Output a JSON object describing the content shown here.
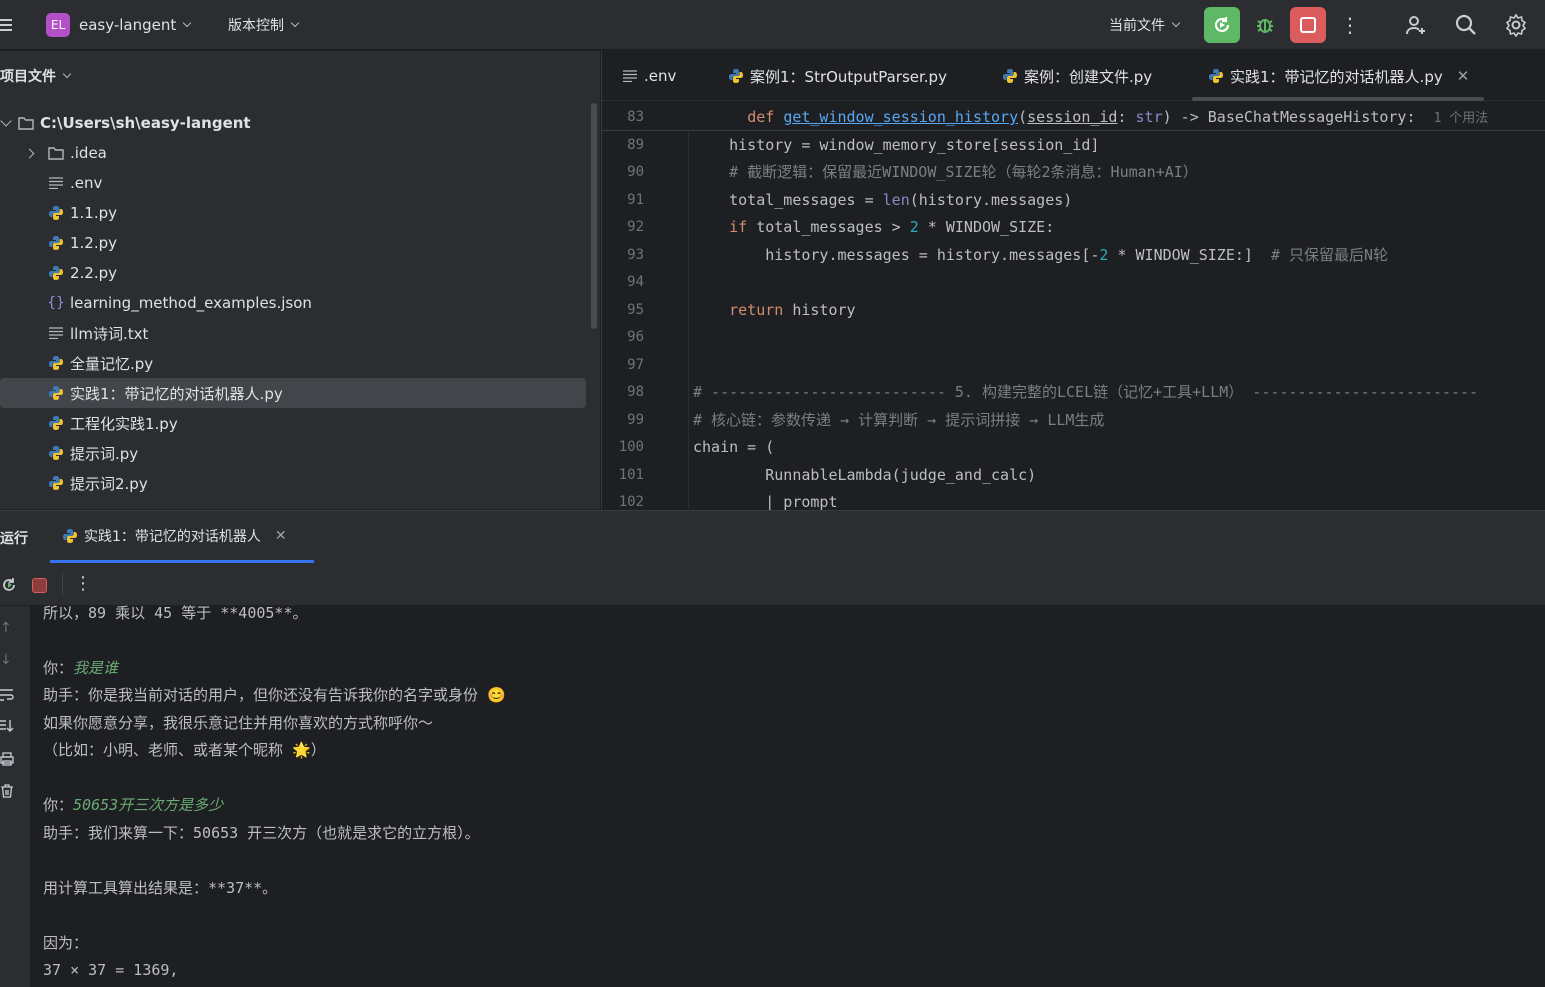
{
  "topbar": {
    "project_badge": "EL",
    "project_name": "easy-langent",
    "vcs_label": "版本控制",
    "run_config": "当前文件"
  },
  "project_panel": {
    "title": "项目文件",
    "root": "C:\\Users\\sh\\easy-langent",
    "items": [
      {
        "label": ".idea",
        "icon": "folder-icon"
      },
      {
        "label": ".env",
        "icon": "text-file-icon"
      },
      {
        "label": "1.1.py",
        "icon": "python-file-icon"
      },
      {
        "label": "1.2.py",
        "icon": "python-file-icon"
      },
      {
        "label": "2.2.py",
        "icon": "python-file-icon"
      },
      {
        "label": "learning_method_examples.json",
        "icon": "json-file-icon"
      },
      {
        "label": "llm诗词.txt",
        "icon": "text-file-icon"
      },
      {
        "label": "全量记忆.py",
        "icon": "python-file-icon"
      },
      {
        "label": "实践1：带记忆的对话机器人.py",
        "icon": "python-file-icon",
        "selected": true
      },
      {
        "label": "工程化实践1.py",
        "icon": "python-file-icon"
      },
      {
        "label": "提示词.py",
        "icon": "python-file-icon"
      },
      {
        "label": "提示词2.py",
        "icon": "python-file-icon"
      }
    ]
  },
  "editor": {
    "tabs": [
      {
        "label": ".env",
        "icon": "text-file-icon"
      },
      {
        "label": "案例1：StrOutputParser.py",
        "icon": "python-file-icon"
      },
      {
        "label": "案例：创建文件.py",
        "icon": "python-file-icon"
      },
      {
        "label": "实践1：带记忆的对话机器人.py",
        "icon": "python-file-icon",
        "active": true
      }
    ],
    "sticky": {
      "line": "83",
      "kw": "def",
      "fn": "get_window_session_history",
      "param": "session_id",
      "colon": ": ",
      "type": "str",
      "rest": ") -> BaseChatMessageHistory:",
      "usage": "1 个用法"
    },
    "lines": [
      {
        "n": "89",
        "text": "    history = window_memory_store[session_id]"
      },
      {
        "n": "90",
        "text": "    # 截断逻辑：保留最近WINDOW_SIZE轮（每轮2条消息：Human+AI）"
      },
      {
        "n": "91",
        "a": "    total_messages = ",
        "b": "len",
        "c": "(history.messages)"
      },
      {
        "n": "92",
        "a": "    ",
        "kw": "if",
        "c": " total_messages > ",
        "num": "2",
        "d": " * WINDOW_SIZE:"
      },
      {
        "n": "93",
        "a": "        history.messages = history.messages[-",
        "num": "2",
        "d": " * WINDOW_SIZE:]  ",
        "cm": "# 只保留最后N轮"
      },
      {
        "n": "94",
        "text": ""
      },
      {
        "n": "95",
        "a": "    ",
        "kw": "return",
        "c": " history"
      },
      {
        "n": "96",
        "text": ""
      },
      {
        "n": "97",
        "text": ""
      },
      {
        "n": "98",
        "text": "# -------------------------- 5. 构建完整的LCEL链（记忆+工具+LLM） -------------------------"
      },
      {
        "n": "99",
        "text": "# 核心链：参数传递 → 计算判断 → 提示词拼接 → LLM生成"
      },
      {
        "n": "100",
        "text": "chain = ("
      },
      {
        "n": "101",
        "text": "        RunnableLambda(judge_and_calc)"
      },
      {
        "n": "102",
        "text": "        | prompt"
      }
    ]
  },
  "run_panel": {
    "title": "运行",
    "tab_label": "实践1：带记忆的对话机器人",
    "output": {
      "l1": "所以，89 乘以 45 等于 **4005**。",
      "l2_prefix": "你：",
      "l2_user": "我是谁",
      "l3": "助手：你是我当前对话的用户，但你还没有告诉我你的名字或身份 😊",
      "l4": "如果你愿意分享，我很乐意记住并用你喜欢的方式称呼你～",
      "l5": "（比如：小明、老师、或者某个昵称 🌟）",
      "l6_prefix": "你：",
      "l6_user": "50653开三次方是多少",
      "l7": "助手：我们来算一下：50653 开三次方（也就是求它的立方根）。",
      "l8": "用计算工具算出结果是：**37**。",
      "l9": "因为：",
      "l10": "37 × 37 = 1369,"
    }
  },
  "colors": {
    "run_green": "#5fb865",
    "stop_red": "#db5c5c",
    "active_tab_blue": "#3574f0"
  }
}
